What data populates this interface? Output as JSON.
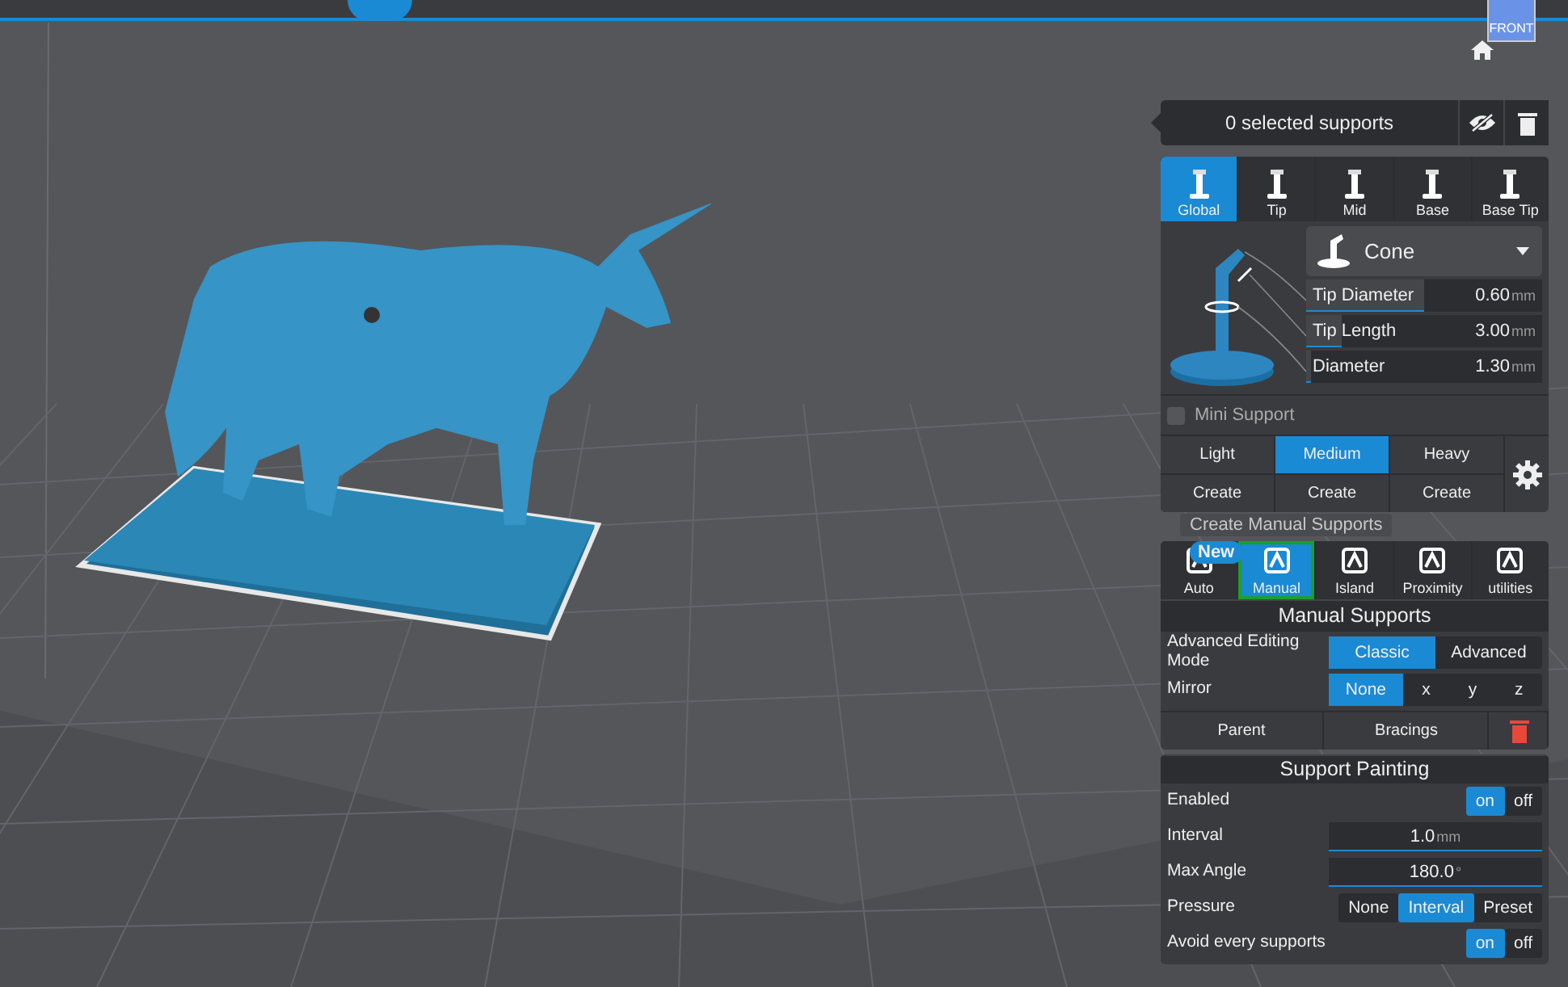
{
  "view_cube": {
    "face": "FRONT"
  },
  "selection": {
    "text": "0 selected supports"
  },
  "support_tabs": [
    {
      "label": "Global",
      "selected": true
    },
    {
      "label": "Tip",
      "selected": false
    },
    {
      "label": "Mid",
      "selected": false
    },
    {
      "label": "Base",
      "selected": false
    },
    {
      "label": "Base Tip",
      "selected": false
    }
  ],
  "shape": {
    "value": "Cone"
  },
  "params": [
    {
      "label": "Tip Diameter",
      "value": "0.60",
      "unit": "mm",
      "level": 0.5
    },
    {
      "label": "Tip Length",
      "value": "3.00",
      "unit": "mm",
      "level": 0.15
    },
    {
      "label": "Diameter",
      "value": "1.30",
      "unit": "mm",
      "level": 0.02
    }
  ],
  "mini_support": {
    "label": "Mini Support",
    "checked": false
  },
  "density": [
    {
      "label": "Light",
      "action": "Create",
      "selected": false
    },
    {
      "label": "Medium",
      "action": "Create",
      "selected": true
    },
    {
      "label": "Heavy",
      "action": "Create",
      "selected": false
    }
  ],
  "tooltip": "Create Manual Supports",
  "modes": [
    {
      "label": "Auto",
      "badge": "New",
      "selected": false
    },
    {
      "label": "Manual",
      "selected": true
    },
    {
      "label": "Island",
      "selected": false
    },
    {
      "label": "Proximity",
      "selected": false
    },
    {
      "label": "utilities",
      "selected": false
    }
  ],
  "manual": {
    "title": "Manual Supports",
    "editing_mode": {
      "label": "Advanced Editing Mode",
      "options": [
        {
          "label": "Classic",
          "selected": true
        },
        {
          "label": "Advanced",
          "selected": false
        }
      ]
    },
    "mirror": {
      "label": "Mirror",
      "options": [
        {
          "label": "None",
          "selected": true
        },
        {
          "label": "x",
          "selected": false
        },
        {
          "label": "y",
          "selected": false
        },
        {
          "label": "z",
          "selected": false
        }
      ]
    },
    "buttons": [
      "Parent",
      "Bracings"
    ]
  },
  "painting": {
    "title": "Support Painting",
    "rows": [
      {
        "kind": "options",
        "label": "Enabled",
        "options": [
          {
            "label": "on",
            "selected": true
          },
          {
            "label": "off",
            "selected": false
          }
        ]
      },
      {
        "kind": "value",
        "label": "Interval",
        "value": "1.0",
        "unit": "mm"
      },
      {
        "kind": "value",
        "label": "Max Angle",
        "value": "180.0",
        "unit": "°"
      },
      {
        "kind": "options",
        "label": "Pressure",
        "options": [
          {
            "label": "None",
            "selected": false
          },
          {
            "label": "Interval",
            "selected": true
          },
          {
            "label": "Preset",
            "selected": false
          }
        ]
      },
      {
        "kind": "options",
        "label": "Avoid every supports",
        "options": [
          {
            "label": "on",
            "selected": true
          },
          {
            "label": "off",
            "selected": false
          }
        ]
      }
    ]
  }
}
